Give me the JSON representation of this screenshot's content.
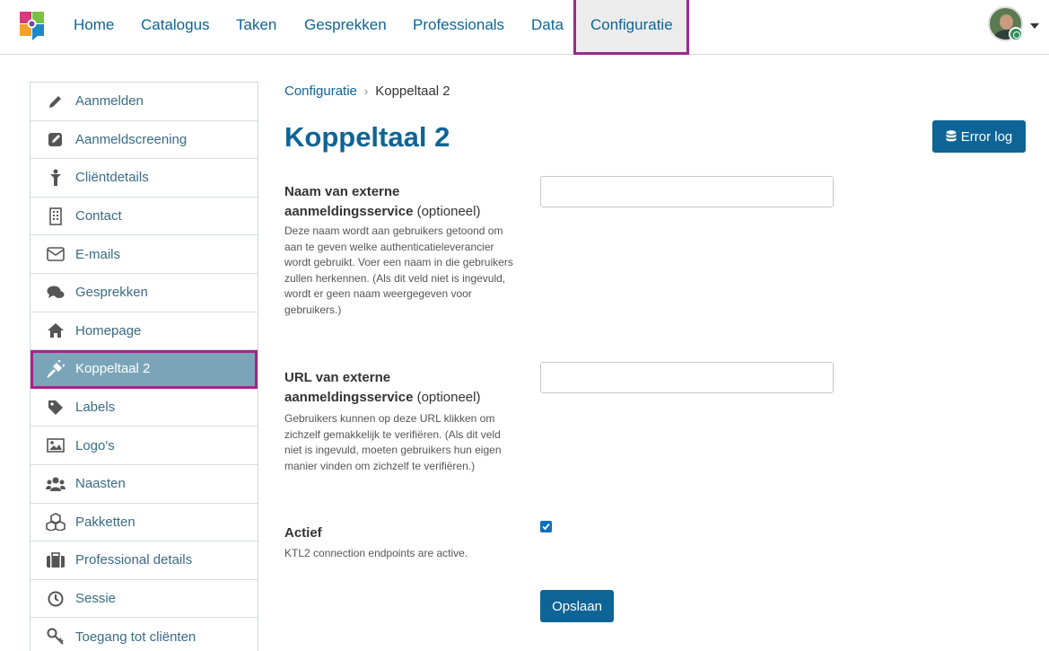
{
  "nav": {
    "items": [
      "Home",
      "Catalogus",
      "Taken",
      "Gesprekken",
      "Professionals",
      "Data",
      "Configuratie"
    ],
    "active": "Configuratie"
  },
  "sidebar": {
    "items": [
      {
        "label": "Aanmelden",
        "icon": "pencil-icon"
      },
      {
        "label": "Aanmeldscreening",
        "icon": "edit-square-icon"
      },
      {
        "label": "Cliëntdetails",
        "icon": "person-icon"
      },
      {
        "label": "Contact",
        "icon": "building-icon"
      },
      {
        "label": "E-mails",
        "icon": "envelope-icon"
      },
      {
        "label": "Gesprekken",
        "icon": "comments-icon"
      },
      {
        "label": "Homepage",
        "icon": "home-icon"
      },
      {
        "label": "Koppeltaal 2",
        "icon": "plug-icon"
      },
      {
        "label": "Labels",
        "icon": "tag-icon"
      },
      {
        "label": "Logo's",
        "icon": "image-icon"
      },
      {
        "label": "Naasten",
        "icon": "users-icon"
      },
      {
        "label": "Pakketten",
        "icon": "cubes-icon"
      },
      {
        "label": "Professional details",
        "icon": "briefcase-icon"
      },
      {
        "label": "Sessie",
        "icon": "clock-icon"
      },
      {
        "label": "Toegang tot cliënten",
        "icon": "key-icon"
      }
    ],
    "active": "Koppeltaal 2"
  },
  "breadcrumb": {
    "parent": "Configuratie",
    "current": "Koppeltaal 2"
  },
  "page": {
    "title": "Koppeltaal 2",
    "error_log_label": "Error log"
  },
  "fields": {
    "name": {
      "label": "Naam van externe aanmeldingsservice",
      "optional": "(optioneel)",
      "help": "Deze naam wordt aan gebruikers getoond om aan te geven welke authenticatieleverancier wordt gebruikt. Voer een naam in die gebruikers zullen herkennen. (Als dit veld niet is ingevuld, wordt er geen naam weergegeven voor gebruikers.)",
      "value": ""
    },
    "url": {
      "label": "URL van externe aanmeldingsservice",
      "optional": "(optioneel)",
      "help": "Gebruikers kunnen op deze URL klikken om zichzelf gemakkelijk te verifiëren. (Als dit veld niet is ingevuld, moeten gebruikers hun eigen manier vinden om zichzelf te verifiëren.)",
      "value": ""
    },
    "active": {
      "label": "Actief",
      "help": "KTL2 connection endpoints are active.",
      "checked": true
    }
  },
  "save_label": "Opslaan",
  "colors": {
    "primary": "#0e6496",
    "highlight": "#9b2a88",
    "active_item": "#7aa5b9"
  }
}
